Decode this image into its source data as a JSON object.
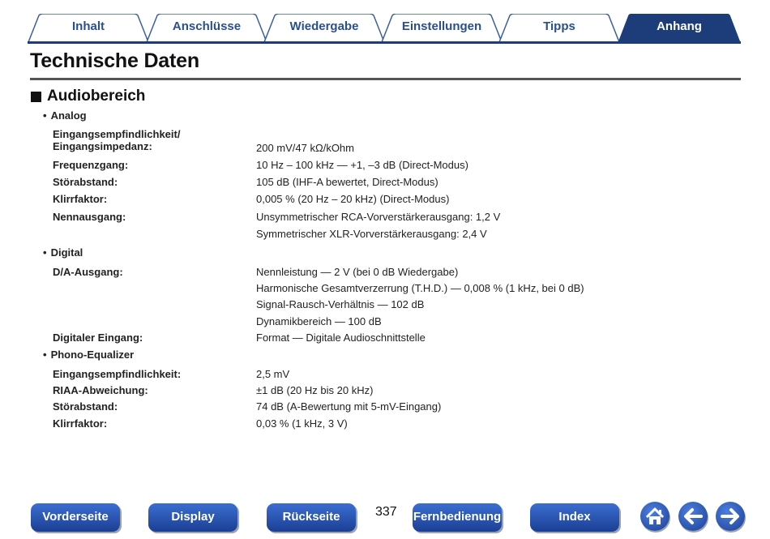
{
  "tabs": [
    {
      "label": "Inhalt"
    },
    {
      "label": "Anschlüsse"
    },
    {
      "label": "Wiedergabe"
    },
    {
      "label": "Einstellungen"
    },
    {
      "label": "Tipps"
    },
    {
      "label": "Anhang"
    }
  ],
  "page_title": "Technische Daten",
  "section_title": "Audiobereich",
  "analog": {
    "title": "Analog",
    "rows": [
      {
        "label1": "Eingangsempfindlichkeit/",
        "label2": "Eingangsimpedanz:",
        "value": "200 mV/47 kΩ/kOhm"
      },
      {
        "label": "Frequenzgang:",
        "value": "10 Hz – 100 kHz — +1, –3 dB (Direct-Modus)"
      },
      {
        "label": "Störabstand:",
        "value": "105 dB (IHF-A bewertet, Direct-Modus)"
      },
      {
        "label": "Klirrfaktor:",
        "value": "0,005 % (20 Hz – 20 kHz) (Direct-Modus)"
      },
      {
        "label": "Nennausgang:",
        "value": "Unsymmetrischer RCA-Vorverstärkerausgang: 1,2 V",
        "value2": "Symmetrischer XLR-Vorverstärkerausgang: 2,4 V"
      }
    ]
  },
  "digital": {
    "title": "Digital",
    "da_label": "D/A-Ausgang:",
    "da_values": [
      "Nennleistung — 2 V (bei 0 dB Wiedergabe)",
      "Harmonische Gesamtverzerrung (T.H.D.) — 0,008 % (1 kHz, bei 0 dB)",
      "Signal-Rausch-Verhältnis — 102 dB",
      "Dynamikbereich — 100 dB"
    ],
    "input_label": "Digitaler Eingang:",
    "input_value": "Format — Digitale Audioschnittstelle"
  },
  "phono": {
    "title": "Phono-Equalizer",
    "rows": [
      {
        "label": "Eingangsempfindlichkeit:",
        "value": "2,5 mV"
      },
      {
        "label": "RIAA-Abweichung:",
        "value": "±1 dB (20 Hz bis 20 kHz)"
      },
      {
        "label": "Störabstand:",
        "value": "74 dB (A-Bewertung mit 5-mV-Eingang)"
      },
      {
        "label": "Klirrfaktor:",
        "value": "0,03 % (1 kHz, 3 V)"
      }
    ]
  },
  "nav": {
    "front": "Vorderseite",
    "display": "Display",
    "rear": "Rückseite",
    "page": "337",
    "remote": "Fernbedienung",
    "index": "Index"
  },
  "icons": {
    "home": "home-icon",
    "back": "arrow-left-icon",
    "forward": "arrow-right-icon"
  },
  "colors": {
    "accent": "#1c3d7a",
    "tab_text": "#2a4f8f",
    "button": "#2a56b8"
  }
}
